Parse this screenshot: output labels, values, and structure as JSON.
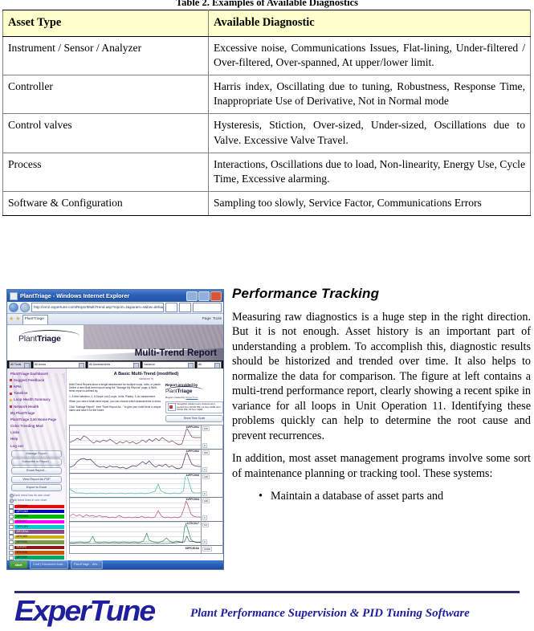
{
  "table": {
    "caption": "Table 2. Examples of Available Diagnostics",
    "headers": [
      "Asset Type",
      "Available Diagnostic"
    ],
    "rows": [
      {
        "asset": "Instrument / Sensor / Analyzer",
        "diagnostic": "Excessive noise, Communications Issues, Flat-lining, Under-filtered / Over-filtered, Over-spanned, At upper/lower limit."
      },
      {
        "asset": "Controller",
        "diagnostic": "Harris index, Oscillating due to tuning, Robustness, Response Time, Inappropriate Use of Derivative, Not in Normal mode"
      },
      {
        "asset": "Control valves",
        "diagnostic": "Hysteresis, Stiction, Over-sized, Under-sized, Oscillations due to Valve.  Excessive Valve Travel."
      },
      {
        "asset": "Process",
        "diagnostic": "Interactions, Oscillations due to load, Non-linearity, Energy Use, Cycle Time, Excessive alarming."
      },
      {
        "asset": "Software & Configuration",
        "diagnostic": "Sampling too slowly, Service Factor, Communications Errors"
      }
    ]
  },
  "figure": {
    "browser": {
      "window_title": "PlantTriage - Windows Internet Explorer",
      "url": "http://vm2.expertune.com/ReportMultiTrend.asp?report=2&param=4&bw=default",
      "tab_label": "PlantTriage",
      "toolbar_page_label": "Page",
      "toolbar_tools_label": "Tools"
    },
    "report": {
      "brand_light": "Plant",
      "brand_bold": "Triage",
      "banner_title": "Multi-Trend Report",
      "filters": [
        "All Tools",
        "All Areas",
        "All Assessments",
        "Variance",
        "All"
      ],
      "heading": "A Basic Multi-Trend (modified)",
      "subheading": "Variance %",
      "paragraphs": [
        "Multi-Trend Reports show a single assessment for multiple loops, units, or plants. Define a new Multi-trend report using the \"Manage My Reports\" page. A Multi-trend report is defined by:",
        "1. A time selection.  2. A Scope List (Loops, Units, Plants).  3. An assessment.",
        "When you view a Multi-trend report, you can choose which assessments to show.",
        "Click \"Manage Report\", then \"Save Report As...\" to give your multi-trend a unique name and save it for the future."
      ],
      "provided_by": "Report provided by",
      "credit_prefix": "Report created by",
      "credit_link": "ExperTune",
      "snapshot_text": "Snapshot values every assessment period from 00:00 PM, 13 Nov 2008 until 00:00 PM, 15 Nov 2008",
      "reset_button": "Reset Time Scale"
    },
    "sidebar": {
      "links": [
        "PlantTriage Dashboard",
        "Suggest Feedback",
        "KPIs",
        "Timeline",
        "Loop Health Summary",
        "Network Health",
        "My PlantTriage",
        "PlantTriage 3.50 Home Page",
        "Color Trending Mod",
        "Links",
        "Help",
        "Log out"
      ],
      "buttons": [
        "Manage Report",
        "Subscribe to Report...",
        "Email Report...",
        "View Report As PDF",
        "Export to Excel"
      ],
      "options": [
        "Each trend has its own chart",
        "All trend lines in one chart"
      ]
    },
    "legend": [
      {
        "label": "11FFC001",
        "color": "#ff0000"
      },
      {
        "label": "11FFC002",
        "color": "#0000cc"
      },
      {
        "label": "11FFC003",
        "color": "#00bb00"
      },
      {
        "label": "11TIC017",
        "color": "#ff00ff"
      },
      {
        "label": "11FFC004",
        "color": "#00cccc"
      },
      {
        "label": "30FC301A",
        "color": "#8b4a8b"
      },
      {
        "label": "11PIC005",
        "color": "#c8b400"
      },
      {
        "label": "11FIC006",
        "color": "#7a9a4a"
      },
      {
        "label": "11LIC007",
        "color": "#8b1a1a"
      },
      {
        "label": "11TIC008",
        "color": "#cc5500"
      },
      {
        "label": "11FIC009",
        "color": "#00aa66"
      }
    ],
    "trends": [
      {
        "tag": "11FFC001",
        "hi": "100",
        "lo": "0",
        "color": "#7a3b52"
      },
      {
        "tag": "11FFC002",
        "hi": "200",
        "lo": "0",
        "color": "#4a3350"
      },
      {
        "tag": "11FFC003",
        "hi": "125",
        "lo": "0",
        "color": "#4fc79a"
      },
      {
        "tag": "11FFC004",
        "hi": "120",
        "lo": "0",
        "color": "#c04a68"
      },
      {
        "tag": "11TIC017",
        "hi": "5.0",
        "lo": "0",
        "color": "#2f8c5a"
      },
      {
        "tag": "30FC301A",
        "hi": "10000",
        "lo": "0",
        "color": "#3a6bb0"
      }
    ],
    "taskbar": {
      "start": "start",
      "items": [
        "Conf | Document Anal...",
        "PlantTriage - Win..."
      ]
    }
  },
  "content": {
    "heading": "Performance Tracking",
    "paragraphs": [
      "Measuring raw diagnostics is a huge step in the right direction.  But it is not enough.  Asset history is an important part of understanding a problem.  To accomplish this, diagnostic results should be historized and trended over time.  It also helps to normalize the data for comparison.  The figure at left contains a multi-trend performance report, clearly showing a recent spike in variance for all loops in Unit Operation 11.  Identifying these problems quickly can help to determine the root cause and prevent recurrences.",
      "In addition, most asset management programs involve some sort of maintenance planning or tracking tool.  These systems:"
    ],
    "bullets": [
      {
        "marker": "•",
        "text": "Maintain a database of asset parts and"
      }
    ]
  },
  "footer": {
    "logo_text": "ExperTune",
    "tagline": "Plant Performance Supervision & PID Tuning Software",
    "brand_color": "#1f1f9e"
  }
}
